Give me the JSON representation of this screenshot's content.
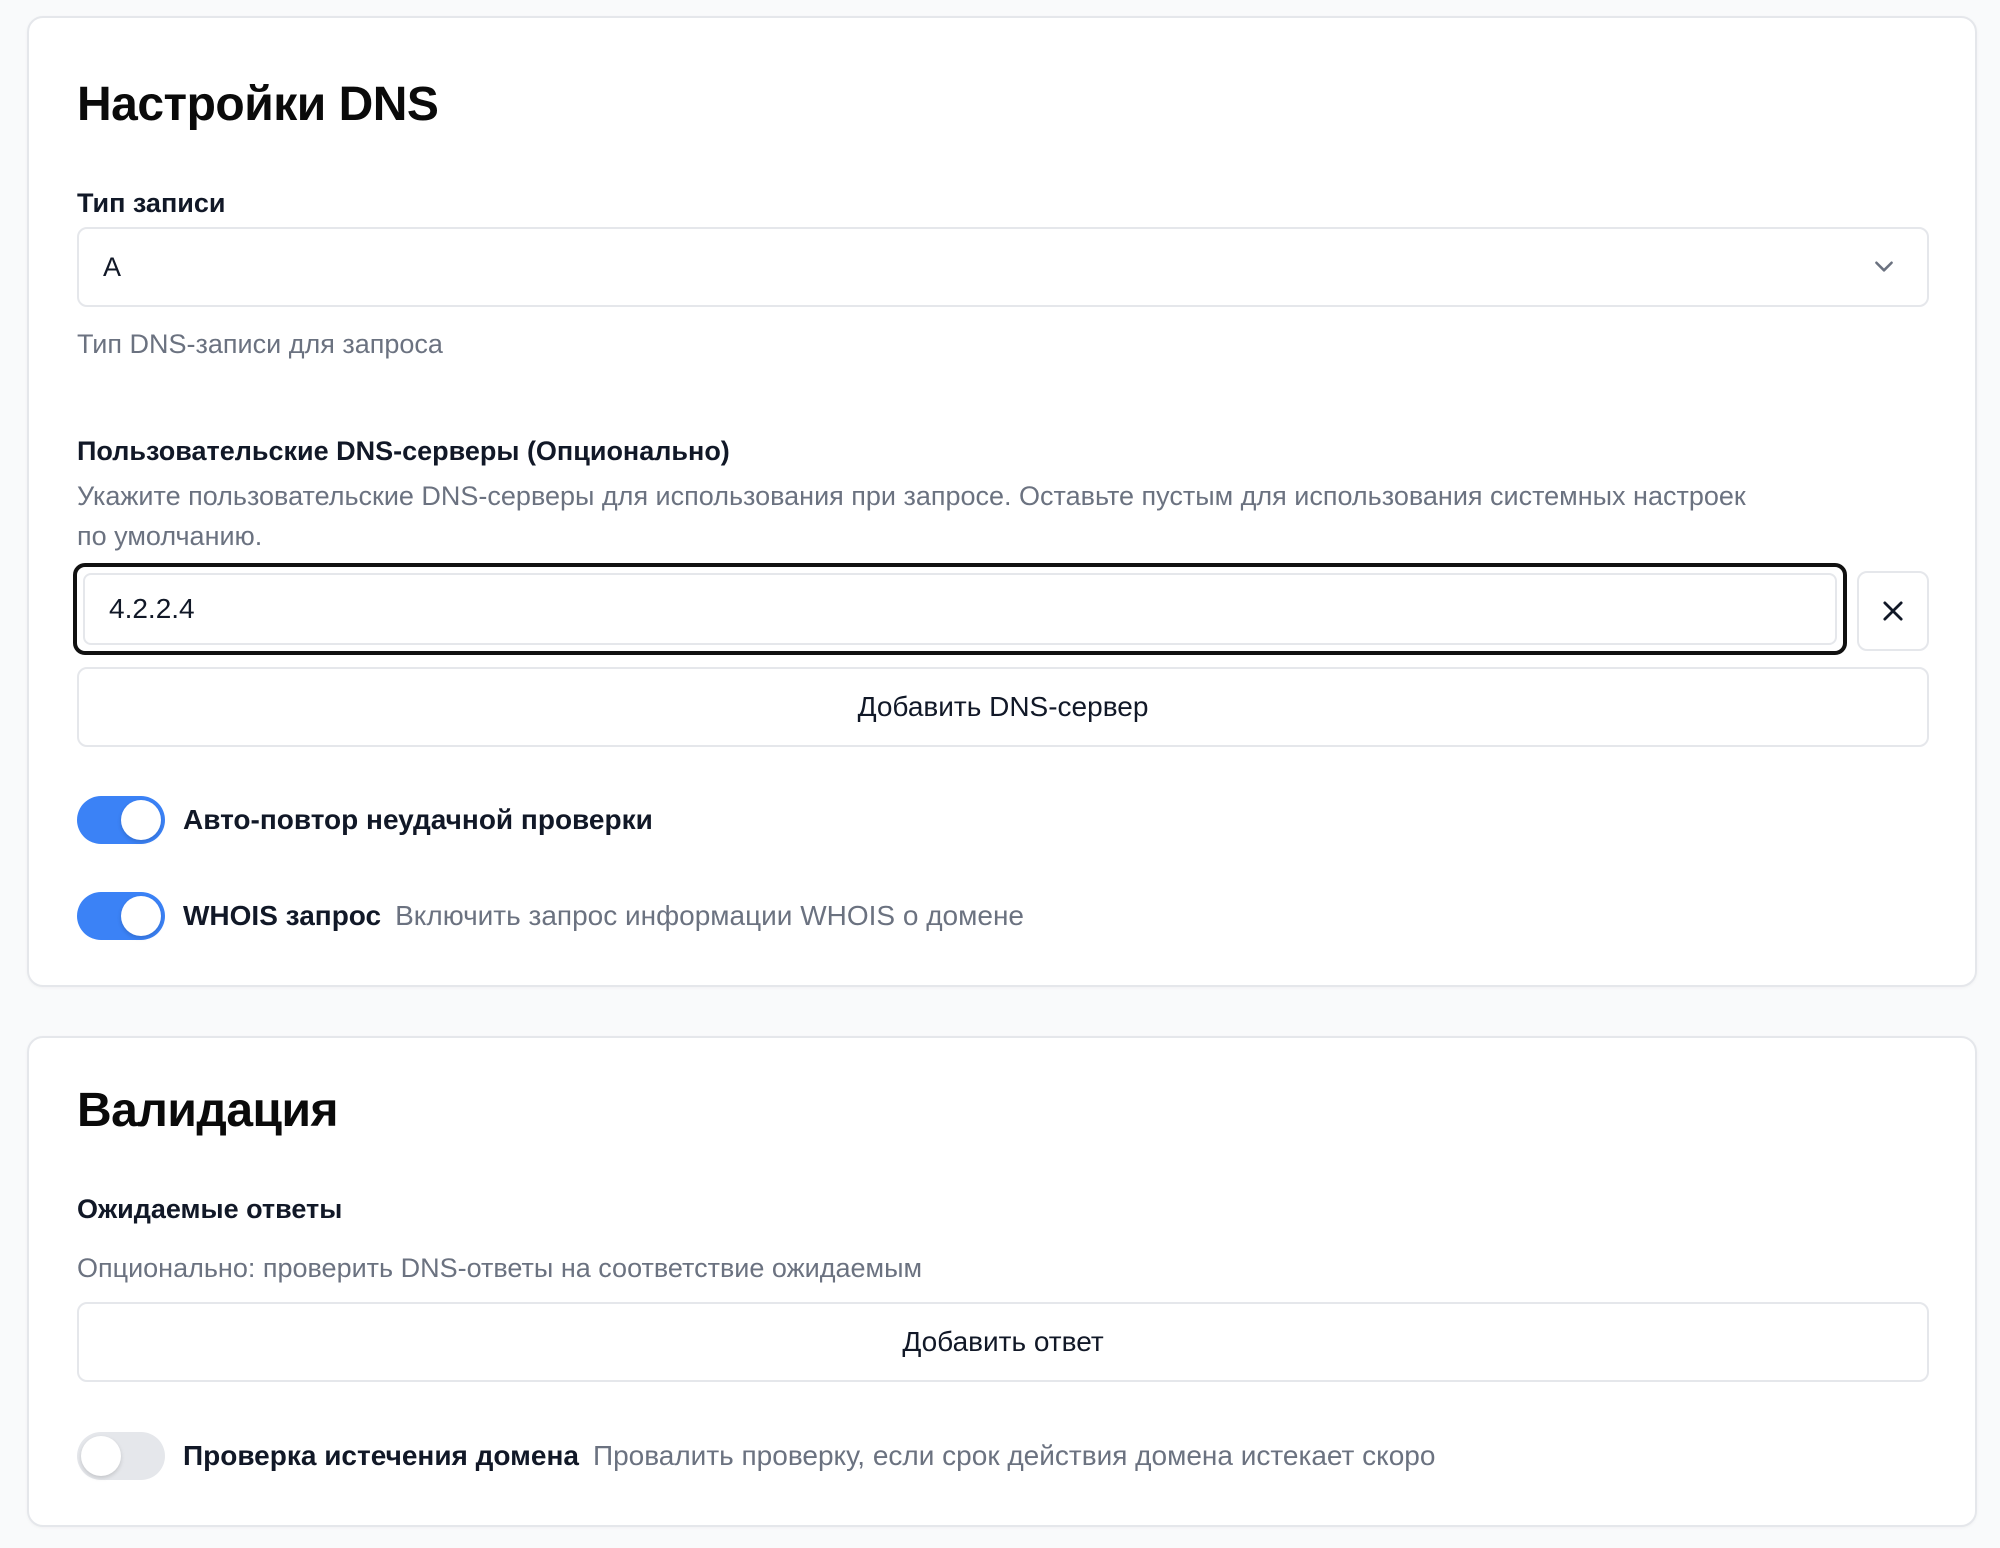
{
  "dns_settings": {
    "title": "Настройки DNS",
    "record_type": {
      "label": "Тип записи",
      "selected": "A",
      "hint": "Тип DNS-записи для запроса"
    },
    "custom_servers": {
      "label": "Пользовательские DNS-серверы (Опционально)",
      "hint_line1": "Укажите пользовательские DNS-серверы для использования при запросе. Оставьте пустым для использования системных настроек",
      "hint_line2": "по умолчанию.",
      "servers": [
        "4.2.2.4"
      ],
      "add_button": "Добавить DNS-сервер"
    },
    "auto_retry": {
      "label": "Авто-повтор неудачной проверки",
      "enabled": true
    },
    "whois": {
      "label": "WHOIS запрос",
      "description": "Включить запрос информации WHOIS о домене",
      "enabled": true
    }
  },
  "validation": {
    "title": "Валидация",
    "expected_answers": {
      "label": "Ожидаемые ответы",
      "hint": "Опционально: проверить DNS-ответы на соответствие ожидаемым",
      "add_button": "Добавить ответ"
    },
    "domain_expiry": {
      "label": "Проверка истечения домена",
      "description": "Провалить проверку, если срок действия домена истекает скоро",
      "enabled": false
    }
  },
  "colors": {
    "toggle_on": "#3b82f6",
    "toggle_off": "#e5e7eb",
    "muted_text": "#6b7280",
    "border": "#e5e7eb"
  }
}
